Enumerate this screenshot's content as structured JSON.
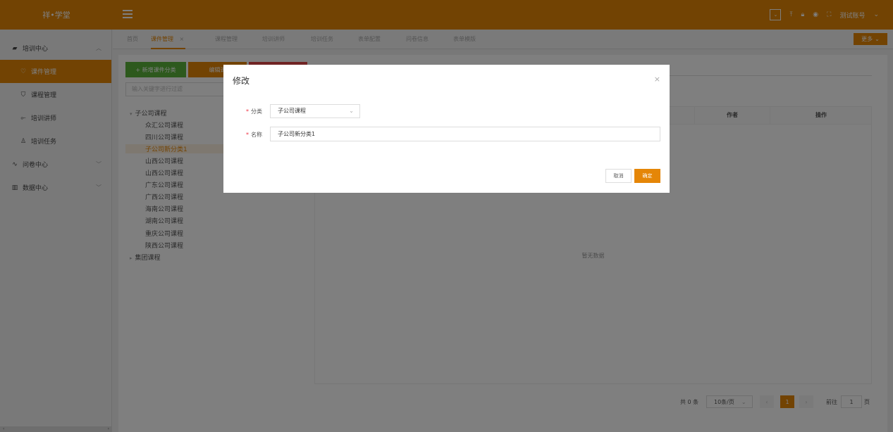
{
  "app": {
    "logo": "祥•学堂"
  },
  "topbar": {
    "right_box": "⌄",
    "account": "测试账号"
  },
  "sidebar": {
    "items": [
      {
        "label": "培训中心",
        "icon": "briefcase-icon",
        "level": "top",
        "expanded": true
      },
      {
        "label": "课件管理",
        "icon": "heart-icon",
        "level": "sub",
        "active": true
      },
      {
        "label": "课程管理",
        "icon": "shirt-icon",
        "level": "sub"
      },
      {
        "label": "培训讲师",
        "icon": "pointer-icon",
        "level": "sub"
      },
      {
        "label": "培训任务",
        "icon": "user-icon",
        "level": "sub"
      },
      {
        "label": "问卷中心",
        "icon": "pulse-icon",
        "level": "top"
      },
      {
        "label": "数据中心",
        "icon": "chart-icon",
        "level": "top"
      }
    ]
  },
  "tabs": [
    {
      "label": "首页"
    },
    {
      "label": "课件管理",
      "active": true,
      "close": "×"
    },
    {
      "label": "课程管理"
    },
    {
      "label": "培训讲师"
    },
    {
      "label": "培训任务"
    },
    {
      "label": "表单配置"
    },
    {
      "label": "问卷信息"
    },
    {
      "label": "表单模版"
    }
  ],
  "more_label": "更多",
  "toolbar": {
    "add_label": "+ 新增课件分类",
    "edit_label": "编辑课"
  },
  "filter": {
    "placeholder": "输入关键字进行过滤"
  },
  "tree": {
    "root1": "子公司课程",
    "children": [
      "众汇公司课程",
      "四川公司课程",
      "子公司新分类1",
      "山西公司课程",
      "山西公司课程",
      "广东公司课程",
      "广西公司课程",
      "海南公司课程",
      "湖南公司课程",
      "重庆公司课程",
      "陕西公司课程"
    ],
    "root2": "集团课程"
  },
  "table": {
    "col_author": "作者",
    "col_actions": "操作",
    "empty": "暂无数据"
  },
  "pager": {
    "total": "共 0 条",
    "page_size": "10条/页",
    "current": "1",
    "goto_prefix": "前往",
    "goto_value": "1",
    "goto_suffix": "页"
  },
  "modal": {
    "title": "修改",
    "close": "×",
    "category_label": "分类",
    "category_value": "子公司课程",
    "name_label": "名称",
    "name_value": "子公司新分类1",
    "cancel": "取消",
    "confirm": "确定"
  }
}
